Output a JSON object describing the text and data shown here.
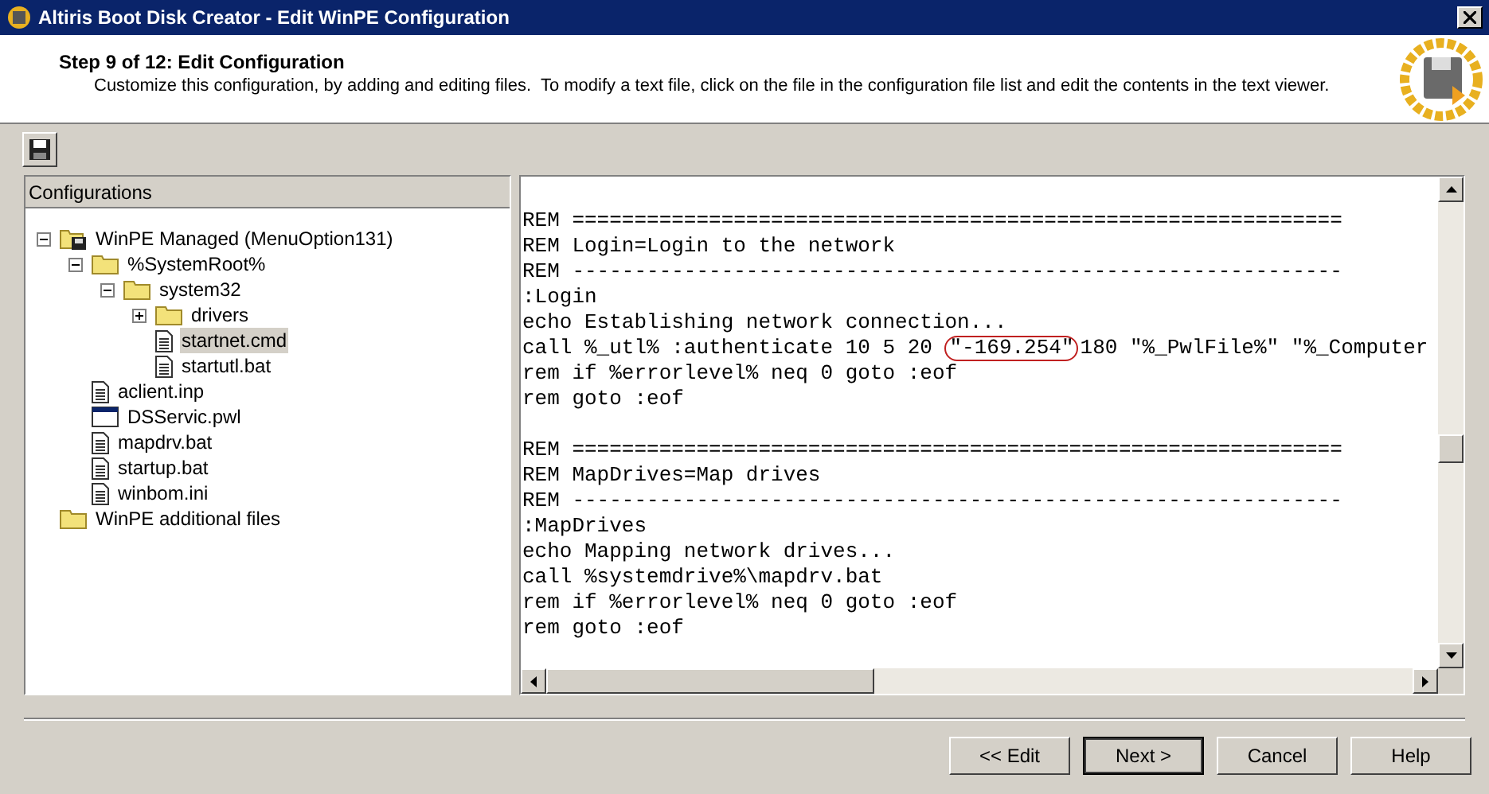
{
  "window": {
    "title": "Altiris Boot Disk Creator - Edit WinPE Configuration"
  },
  "header": {
    "step": "Step 9 of 12: Edit Configuration",
    "description": "Customize this configuration, by adding and editing files.  To modify a text file, click on the file in the configuration file list and edit the contents in the text viewer."
  },
  "tree": {
    "heading": "Configurations",
    "items": [
      {
        "label": "WinPE Managed (MenuOption131)",
        "kind": "disk-folder",
        "expanded": true,
        "selected": false,
        "children": [
          {
            "label": "%SystemRoot%",
            "kind": "folder",
            "expanded": true,
            "selected": false,
            "children": [
              {
                "label": "system32",
                "kind": "folder",
                "expanded": true,
                "selected": false,
                "children": [
                  {
                    "label": "drivers",
                    "kind": "folder",
                    "expanded": false,
                    "selected": false
                  },
                  {
                    "label": "startnet.cmd",
                    "kind": "file",
                    "selected": true
                  },
                  {
                    "label": "startutl.bat",
                    "kind": "file",
                    "selected": false
                  }
                ]
              }
            ]
          },
          {
            "label": "aclient.inp",
            "kind": "file",
            "selected": false
          },
          {
            "label": "DSServic.pwl",
            "kind": "window",
            "selected": false
          },
          {
            "label": "mapdrv.bat",
            "kind": "file",
            "selected": false
          },
          {
            "label": "startup.bat",
            "kind": "file",
            "selected": false
          },
          {
            "label": "winbom.ini",
            "kind": "file",
            "selected": false
          }
        ]
      },
      {
        "label": "WinPE additional files",
        "kind": "folder",
        "selected": false
      }
    ]
  },
  "editor": {
    "lines": [
      {
        "kind": "blank"
      },
      {
        "kind": "plain",
        "text": "REM =============================================================="
      },
      {
        "kind": "plain",
        "text": "REM Login=Login to the network"
      },
      {
        "kind": "plain",
        "text": "REM --------------------------------------------------------------"
      },
      {
        "kind": "plain",
        "text": ":Login"
      },
      {
        "kind": "plain",
        "text": "echo Establishing network connection..."
      },
      {
        "kind": "circled",
        "before": "call %_utl% :authenticate 10 5 20 ",
        "circled": "\"-169.254\"",
        "after": "180 \"%_PwlFile%\" \"%_Computer"
      },
      {
        "kind": "plain",
        "text": "rem if %errorlevel% neq 0 goto :eof"
      },
      {
        "kind": "plain",
        "text": "rem goto :eof"
      },
      {
        "kind": "blank"
      },
      {
        "kind": "plain",
        "text": "REM =============================================================="
      },
      {
        "kind": "plain",
        "text": "REM MapDrives=Map drives"
      },
      {
        "kind": "plain",
        "text": "REM --------------------------------------------------------------"
      },
      {
        "kind": "plain",
        "text": ":MapDrives"
      },
      {
        "kind": "plain",
        "text": "echo Mapping network drives..."
      },
      {
        "kind": "plain",
        "text": "call %systemdrive%\\mapdrv.bat"
      },
      {
        "kind": "plain",
        "text": "rem if %errorlevel% neq 0 goto :eof"
      },
      {
        "kind": "plain",
        "text": "rem goto :eof"
      }
    ]
  },
  "buttons": [
    {
      "label": "<< Edit",
      "default": false
    },
    {
      "label": "Next >",
      "default": true
    },
    {
      "label": "Cancel",
      "default": false
    },
    {
      "label": "Help",
      "default": false
    }
  ]
}
